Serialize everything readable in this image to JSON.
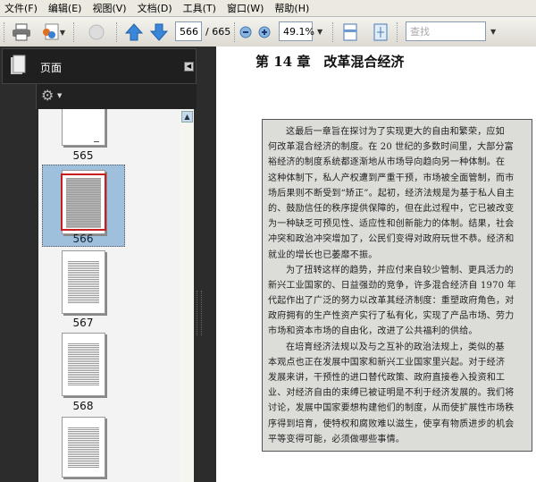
{
  "menu": [
    "文件(F)",
    "编辑(E)",
    "视图(V)",
    "文档(D)",
    "工具(T)",
    "窗口(W)",
    "帮助(H)"
  ],
  "toolbar": {
    "page_current": "566",
    "page_total": "/ 665",
    "zoom": "49.1%",
    "search_placeholder": "查找"
  },
  "panel": {
    "title": "页面",
    "thumbnails": [
      {
        "label": "565"
      },
      {
        "label": "566",
        "selected": true
      },
      {
        "label": "567"
      },
      {
        "label": "568"
      },
      {
        "label": ""
      }
    ]
  },
  "document": {
    "chapter_title": "第 14 章　改革混合经济",
    "paragraphs": [
      [
        "这最后一章旨在探讨为了实现更大的自由和繁荣，应如",
        "何改革混合经济的制度。在 20 世纪的多数时间里，大部分富",
        "裕经济的制度系统都逐渐地从市场导向趋向另一种体制。在",
        "这种体制下，私人产权遭到严重干预，市场被全面管制，而市",
        "场后果则不断受到“矫正”。起初，经济法规是为基于私人自主",
        "的、鼓励信任的秩序提供保障的，但在此过程中，它已被改变",
        "为一种缺乏可预见性、适应性和创新能力的体制。结果，社会",
        "冲突和政治冲突增加了，公民们变得对政府玩世不恭。经济和",
        "就业的增长也已萎靡不振。"
      ],
      [
        "为了扭转这样的趋势，并应付来自较少管制、更具活力的",
        "新兴工业国家的、日益强劲的竞争，许多混合经济自 1970 年",
        "代起作出了广泛的努力以改革其经济制度：重塑政府角色，对",
        "政府拥有的生产性资产实行了私有化，实现了产品市场、劳力",
        "市场和资本市场的自由化，改进了公共福利的供给。"
      ],
      [
        "在培育经济法规以及与之互补的政治法规上，类似的基",
        "本观点也正在发展中国家和新兴工业国家里兴起。对于经济",
        "发展来讲，干预性的进口替代政策、政府直接卷入投资和工",
        "业、对经济自由的束缚已被证明是不利于经济发展的。我们将",
        "讨论，发展中国家要想构建他们的制度，从而使扩展性市场秩",
        "序得到培育，使特权和腐败难以滋生，使享有物质进步的机会",
        "平等变得可能，必须做哪些事情。"
      ]
    ]
  }
}
